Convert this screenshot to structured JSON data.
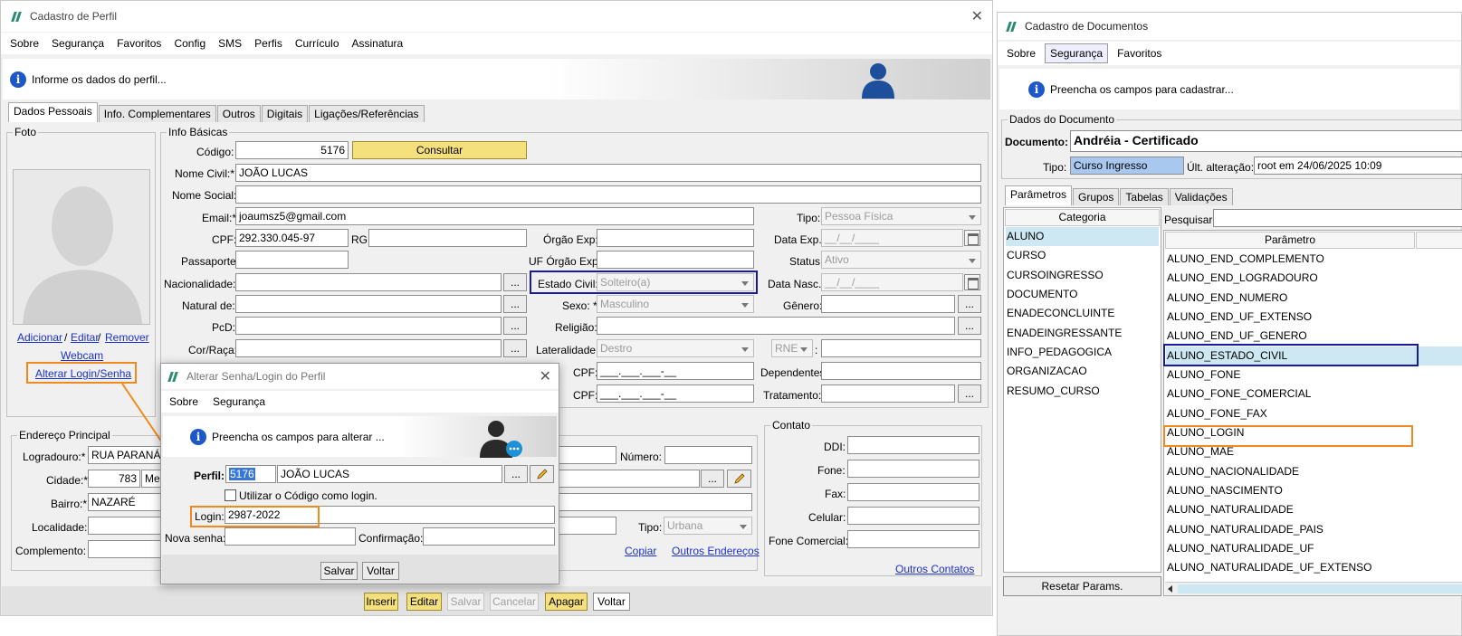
{
  "left_window": {
    "title": "Cadastro de Perfil",
    "menu": [
      "Sobre",
      "Segurança",
      "Favoritos",
      "Config",
      "SMS",
      "Perfis",
      "Currículo",
      "Assinatura"
    ],
    "info_text": "Informe os dados do perfil...",
    "tabs": [
      "Dados Pessoais",
      "Info. Complementares",
      "Outros",
      "Digitais",
      "Ligações/Referências"
    ],
    "foto": {
      "legend": "Foto",
      "adicionar": "Adicionar",
      "editar": "Editar",
      "remover": "Remover",
      "webcam": "Webcam",
      "alterar_login": "Alterar Login/Senha",
      "sep": "/"
    },
    "info_basicas": {
      "legend": "Info Básicas",
      "codigo_label": "Código:",
      "codigo": "5176",
      "consultar": "Consultar",
      "nome_civil_label": "Nome Civil:*",
      "nome_civil": "JOÃO LUCAS",
      "nome_social_label": "Nome Social:",
      "email_label": "Email:*",
      "email": "joaumsz5@gmail.com",
      "tipo_label": "Tipo:",
      "tipo": "Pessoa Física",
      "cpf_label": "CPF:",
      "cpf": "292.330.045-97",
      "rg_label": "RG:",
      "orgao_exp_label": "Órgão Exp:",
      "data_exp_label": "Data Exp.:",
      "date_mask": "__/__/____",
      "passaporte_label": "Passaporte:",
      "uf_orgao_label": "UF Órgão Exp:",
      "status_label": "Status:",
      "status": "Ativo",
      "nacionalidade_label": "Nacionalidade:",
      "estado_civil_label": "Estado Civil:",
      "estado_civil": "Solteiro(a)",
      "data_nasc_label": "Data Nasc.:",
      "natural_label": "Natural de:",
      "sexo_label": "Sexo: *",
      "sexo": "Masculino",
      "genero_label": "Gênero:",
      "pcd_label": "PcD:",
      "religiao_label": "Religião:",
      "cor_label": "Cor/Raça:",
      "lateralidade_label": "Lateralidade:",
      "lateralidade": "Destro",
      "rne": "RNE",
      "colon": ":",
      "cpf2_label": "CPF:",
      "cpf_mask": "___.___.___-__",
      "dependentes_label": "Dependentes:",
      "cpf3_label": "CPF:",
      "tratamento_label": "Tratamento:",
      "ellipsis": "..."
    },
    "endereco": {
      "legend": "Endereço Principal",
      "logradouro_label": "Logradouro:*",
      "logradouro": "RUA PARANÁ",
      "numero_label": "Número:",
      "cidade_label": "Cidade:*",
      "cidade_code": "783",
      "cidade_name": "Me",
      "bairro_label": "Bairro:*",
      "bairro": "NAZARÉ",
      "localidade_label": "Localidade:",
      "tipo_label": "Tipo:",
      "tipo": "Urbana",
      "complemento_label": "Complemento:",
      "copiar": "Copiar",
      "outros_enderecos": "Outros Endereços"
    },
    "contato": {
      "legend": "Contato",
      "ddi_label": "DDI:",
      "fone_label": "Fone:",
      "fax_label": "Fax:",
      "celular_label": "Celular:",
      "fone_comercial_label": "Fone Comercial:",
      "outros_contatos": "Outros Contatos"
    },
    "bottom_buttons": [
      "Inserir",
      "Editar",
      "Salvar",
      "Cancelar",
      "Apagar",
      "Voltar"
    ]
  },
  "dialog": {
    "title": "Alterar Senha/Login do Perfil",
    "menu": [
      "Sobre",
      "Segurança"
    ],
    "info_text": "Preencha os campos para alterar ...",
    "perfil_label": "Perfil:",
    "perfil_code": "5176",
    "perfil_name": "JOÃO LUCAS",
    "checkbox_label": "Utilizar o Código como login.",
    "login_label": "Login:",
    "login": "2987-2022",
    "nova_senha_label": "Nova senha:",
    "confirmacao_label": "Confirmação:",
    "salvar": "Salvar",
    "voltar": "Voltar",
    "ellipsis": "..."
  },
  "right_window": {
    "title": "Cadastro de Documentos",
    "menu": [
      "Sobre",
      "Segurança",
      "Favoritos"
    ],
    "info_text": "Preencha os campos para cadastrar...",
    "dados_legend": "Dados do Documento",
    "documento_label": "Documento:",
    "documento": "Andréia - Certificado",
    "tipo_label": "Tipo:",
    "tipo": "Curso Ingresso",
    "ult_alt_label": "Últ. alteração:",
    "ult_alt": "root em 24/06/2025 10:09",
    "tabs": [
      "Parâmetros",
      "Grupos",
      "Tabelas",
      "Validações"
    ],
    "categoria_header": "Categoria",
    "categorias": [
      "ALUNO",
      "CURSO",
      "CURSOINGRESSO",
      "DOCUMENTO",
      "ENADECONCLUINTE",
      "ENADEINGRESSANTE",
      "INFO_PEDAGOGICA",
      "ORGANIZACAO",
      "RESUMO_CURSO"
    ],
    "pesquisar_label": "Pesquisar:",
    "parametro_header": "Parâmetro",
    "parametros": [
      "ALUNO_END_COMPLEMENTO",
      "ALUNO_END_LOGRADOURO",
      "ALUNO_END_NUMERO",
      "ALUNO_END_UF_EXTENSO",
      "ALUNO_END_UF_GENERO",
      "ALUNO_ESTADO_CIVIL",
      "ALUNO_FONE",
      "ALUNO_FONE_COMERCIAL",
      "ALUNO_FONE_FAX",
      "ALUNO_LOGIN",
      "ALUNO_MAE",
      "ALUNO_NACIONALIDADE",
      "ALUNO_NASCIMENTO",
      "ALUNO_NATURALIDADE",
      "ALUNO_NATURALIDADE_PAIS",
      "ALUNO_NATURALIDADE_UF",
      "ALUNO_NATURALIDADE_UF_EXTENSO"
    ],
    "resetar": "Resetar Params."
  },
  "colors": {
    "highlight_blue": "#1a1a9e",
    "highlight_orange": "#f08a1e",
    "selected_row": "#cde8f2",
    "link": "#1b31c8",
    "yellow_button": "#f4e07c"
  }
}
